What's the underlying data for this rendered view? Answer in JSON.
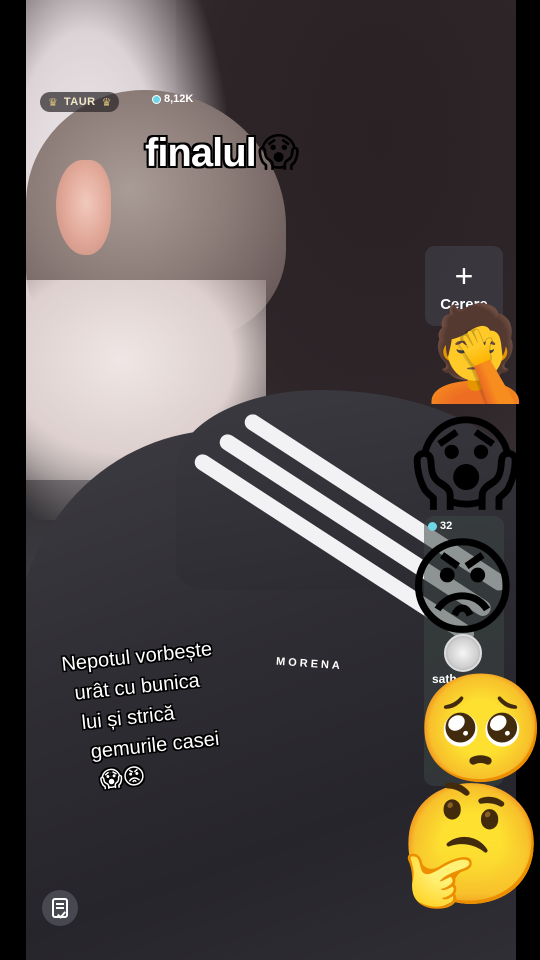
{
  "live": {
    "streamer_name": "TAUR",
    "viewer_count": "8,12K",
    "panel_count": "32",
    "request_label": "Cerere",
    "panel_username": "sath"
  },
  "title": {
    "text": "finalul",
    "emoji": "😱"
  },
  "caption": {
    "line1": "Nepotul vorbește",
    "line2": "urât cu bunica",
    "line3": "lui și strică",
    "line4": "gemurile casei",
    "emojis": "😱😡"
  },
  "watermark": "MORENA",
  "reactions": [
    "🤦",
    "😱",
    "😡",
    "🥺",
    "🤔"
  ],
  "icons": {
    "crown": "crown-icon",
    "plus": "plus-icon",
    "document": "document-check-icon"
  }
}
